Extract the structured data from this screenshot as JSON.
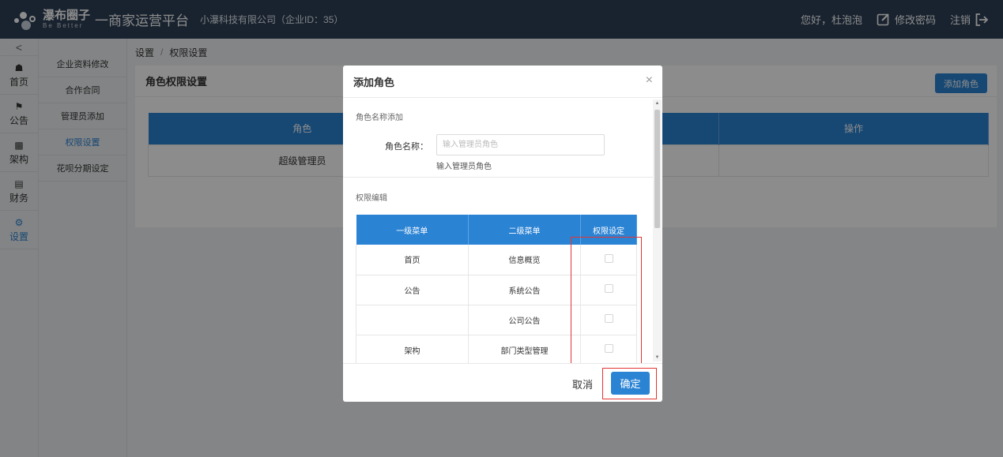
{
  "header": {
    "brand_name": "瀑布圈子",
    "brand_slogan": "Be Better",
    "platform_title": "一商家运营平台",
    "company_info": "小瀑科技有限公司（企业ID：35）",
    "greeting": "您好，杜泡泡",
    "change_password": "修改密码",
    "logout": "注销"
  },
  "icon_nav": {
    "collapse": "<",
    "items": [
      {
        "label": "首页",
        "icon": "home-icon"
      },
      {
        "label": "公告",
        "icon": "megaphone-icon"
      },
      {
        "label": "架构",
        "icon": "bar-chart-icon"
      },
      {
        "label": "财务",
        "icon": "money-icon"
      },
      {
        "label": "设置",
        "icon": "gear-icon"
      }
    ]
  },
  "sub_nav": {
    "items": [
      "企业资料修改",
      "合作合同",
      "管理员添加",
      "权限设置",
      "花呗分期设定"
    ]
  },
  "breadcrumb": {
    "parent": "设置",
    "separator": "/",
    "current": "权限设置"
  },
  "panel": {
    "title": "角色权限设置",
    "add_role_button": "添加角色",
    "table": {
      "headers": [
        "角色",
        "",
        "操作"
      ],
      "rows": [
        [
          "超级管理员",
          "",
          ""
        ]
      ]
    }
  },
  "modal": {
    "title": "添加角色",
    "close": "×",
    "role_section_title": "角色名称添加",
    "role_name_label": "角色名称：",
    "role_name_placeholder": "输入管理员角色",
    "role_name_value": "",
    "role_name_hint": "输入管理员角色",
    "perm_section_title": "权限编辑",
    "perm_table": {
      "headers": [
        "一级菜单",
        "二级菜单",
        "权限设定"
      ],
      "rows": [
        [
          "首页",
          "信息概览"
        ],
        [
          "公告",
          "系统公告"
        ],
        [
          "",
          "公司公告"
        ],
        [
          "架构",
          "部门类型管理"
        ]
      ]
    },
    "cancel_button": "取消",
    "ok_button": "确定"
  },
  "colors": {
    "header_bg": "#2f4056",
    "accent": "#2b83d4",
    "highlight": "#e53333"
  }
}
